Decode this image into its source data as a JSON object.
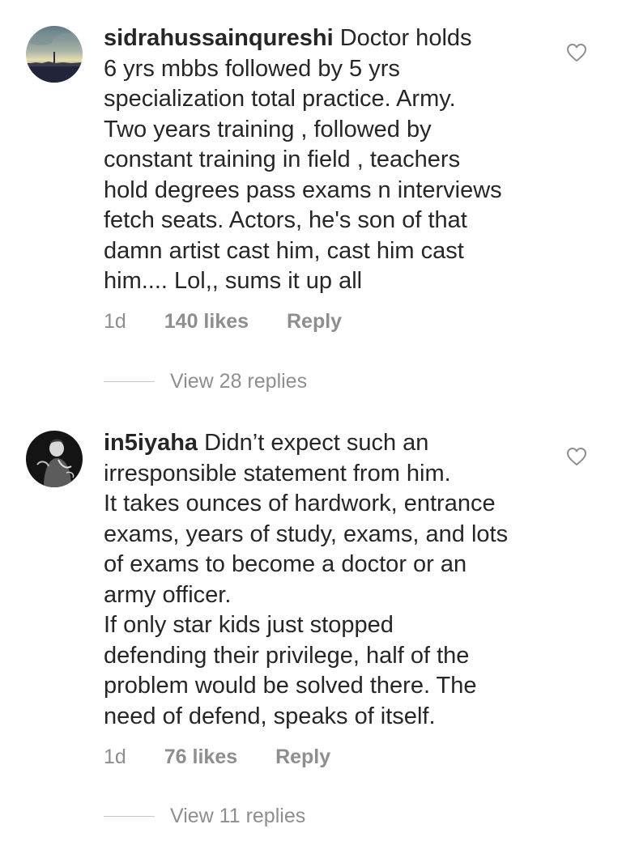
{
  "comments": [
    {
      "username": "sidrahussainqureshi",
      "text_lines": [
        " Doctor holds",
        "6 yrs mbbs followed by 5 yrs",
        "specialization total practice.  Army.",
        "Two years training , followed by",
        "constant training in field , teachers",
        "hold degrees pass exams n interviews",
        "fetch seats. Actors, he's son of that",
        "damn artist cast him, cast him cast",
        "him.... Lol,, sums it up all"
      ],
      "time": "1d",
      "likes": "140 likes",
      "reply": "Reply",
      "view_replies": "View 28 replies",
      "avatar_icon": "avatar-landscape-photo",
      "heart_icon": "heart-outline-icon"
    },
    {
      "username": "in5iyaha",
      "text_lines": [
        " Didn’t expect such an",
        "irresponsible statement from him.",
        "It takes ounces of hardwork, entrance",
        "exams, years of study, exams, and lots",
        "of exams to become a doctor or an",
        "army officer.",
        "If only star kids just stopped",
        "defending their privilege, half of the",
        "problem would be solved there. The",
        "need of defend, speaks of itself."
      ],
      "time": "1d",
      "likes": "76 likes",
      "reply": "Reply",
      "view_replies": "View 11 replies",
      "avatar_icon": "avatar-person-photo",
      "heart_icon": "heart-outline-icon"
    }
  ],
  "colors": {
    "text": "#262626",
    "muted": "#8e8e8e",
    "divider": "#c7c7c7"
  }
}
